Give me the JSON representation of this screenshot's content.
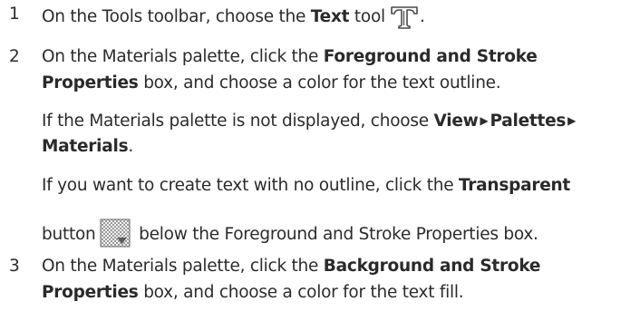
{
  "steps": [
    {
      "number": "1",
      "a": "On the Tools toolbar, choose the ",
      "b": "Text",
      "c": " tool",
      "d": "."
    },
    {
      "number": "2",
      "l1a": "On the Materials palette, click the ",
      "l1b": "Foreground and Stroke",
      "l2a": "Properties",
      "l2b": " box, and choose a color for the text outline."
    },
    {
      "number": "3",
      "l1a": "On the Materials palette, click the ",
      "l1b": "Background and Stroke",
      "l2a": "Properties",
      "l2b": " box, and choose a color for the text fill."
    }
  ],
  "note1": {
    "a": "If the Materials palette is not displayed, choose ",
    "b": "View",
    "c": "Palettes",
    "d": "Materials",
    "e": "."
  },
  "note2": {
    "a": "If you want to create text with no outline, click the ",
    "b": "Transparent",
    "c": "button",
    "d": " below the Foreground and Stroke Properties box."
  },
  "icons": {
    "text_tool": "text-tool-icon",
    "transparent": "transparent-button-icon",
    "arrow": "▶"
  }
}
